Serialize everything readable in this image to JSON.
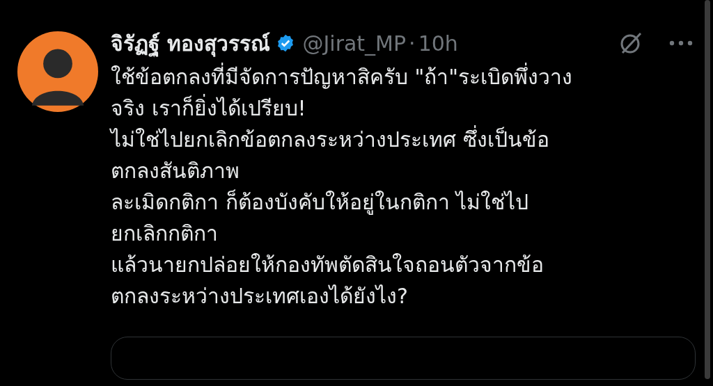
{
  "tweet": {
    "author_name": "จิรัฏฐ์ ทองสุวรรณ์",
    "verified": true,
    "handle": "@Jirat_MP",
    "separator": "·",
    "time": "10h",
    "lines": [
      "ใช้ข้อตกลงที่มีจัดการปัญหาสิครับ \"ถ้า\"ระเบิดพึ่งวาง",
      "จริง เราก็ยิ่งได้เปรียบ!",
      "ไม่ใช่ไปยกเลิกข้อตกลงระหว่างประเทศ ซึ่งเป็นข้อ",
      "ตกลงสันติภาพ",
      "ละเมิดกติกา ก็ต้องบังคับให้อยู่ในกติกา ไม่ใช่ไป",
      "ยกเลิกกติกา",
      "แล้วนายกปล่อยให้กองทัพตัดสินใจถอนตัวจากข้อ",
      "ตกลงระหว่างประเทศเองได้ยังไง?"
    ]
  }
}
